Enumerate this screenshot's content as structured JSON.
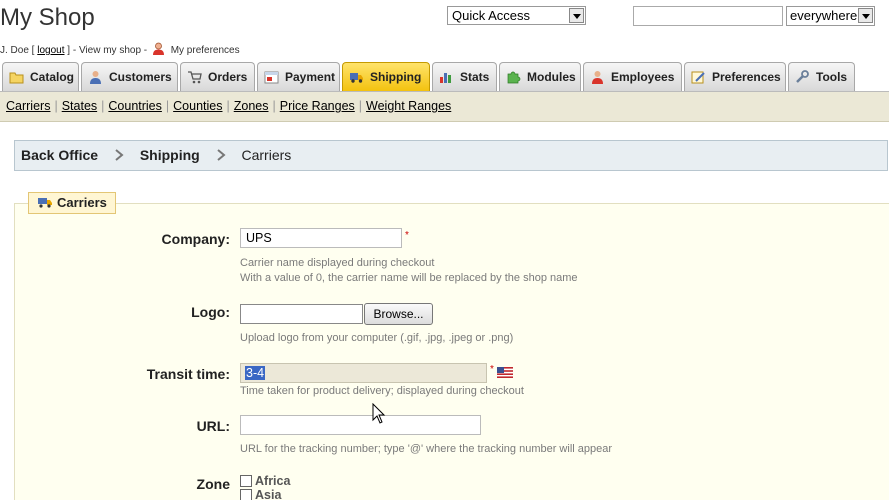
{
  "header": {
    "shop_title": "My Shop",
    "user_prefix": "J. Doe [",
    "logout_label": "logout",
    "user_mid": "] - View my shop -",
    "preferences_label": "My preferences",
    "quick_access_value": "Quick Access",
    "search_value": "",
    "search_scope_value": "everywhere"
  },
  "tabs": [
    {
      "label": "Catalog",
      "icon": "folder-icon"
    },
    {
      "label": "Customers",
      "icon": "customer-icon"
    },
    {
      "label": "Orders",
      "icon": "cart-icon"
    },
    {
      "label": "Payment",
      "icon": "payment-icon"
    },
    {
      "label": "Shipping",
      "icon": "truck-icon",
      "active": true
    },
    {
      "label": "Stats",
      "icon": "bar-chart-icon"
    },
    {
      "label": "Modules",
      "icon": "puzzle-icon"
    },
    {
      "label": "Employees",
      "icon": "employee-icon"
    },
    {
      "label": "Preferences",
      "icon": "preferences-icon"
    },
    {
      "label": "Tools",
      "icon": "wrench-icon"
    }
  ],
  "subnav": [
    "Carriers",
    "States",
    "Countries",
    "Counties",
    "Zones",
    "Price Ranges",
    "Weight Ranges"
  ],
  "breadcrumb": [
    "Back Office",
    "Shipping",
    "Carriers"
  ],
  "form": {
    "legend": "Carriers",
    "company_label": "Company:",
    "company_value": "UPS",
    "company_hint1": "Carrier name displayed during checkout",
    "company_hint2": "With a value of 0, the carrier name will be replaced by the shop name",
    "logo_label": "Logo:",
    "browse_label": "Browse...",
    "logo_hint": "Upload logo from your computer (.gif, .jpg, .jpeg or .png)",
    "transit_label": "Transit time:",
    "transit_value": "3-4",
    "transit_hint": "Time taken for product delivery; displayed during checkout",
    "url_label": "URL:",
    "url_value": "",
    "url_hint": "URL for the tracking number; type '@' where the tracking number will appear",
    "zone_label": "Zone",
    "zones": [
      "Africa",
      "Asia"
    ],
    "required_mark": "*"
  },
  "colors": {
    "active_tab": "#f3c20f",
    "subnav_bg": "#ebe8d6",
    "form_bg": "#fffff0",
    "selection": "#3a67c4",
    "required": "#cc0000"
  }
}
